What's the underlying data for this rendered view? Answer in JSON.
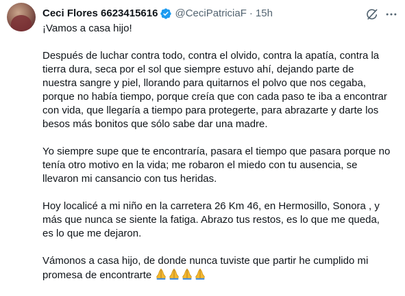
{
  "author": {
    "display_name": "Ceci Flores 6623415616",
    "handle": "@CeciPatriciaF",
    "separator": "·",
    "timestamp": "15h"
  },
  "icons": {
    "verified": "verified-badge-icon",
    "grok": "grok-icon",
    "more": "more-options-icon",
    "emoji": "folded-hands-emoji"
  },
  "colors": {
    "verified_blue": "#1d9bf0",
    "secondary_text": "#536471",
    "primary_text": "#0f1419"
  },
  "tweet": {
    "paragraphs": [
      "¡Vamos a casa hijo!",
      "Después de luchar contra todo, contra el olvido, contra la apatía, contra la\ntierra dura, seca por el sol que siempre estuvo ahí, dejando parte de\nnuestra sangre y piel, llorando para quitarnos el polvo que nos cegaba,\nporque no había tiempo, porque creía que con cada paso te iba a encontrar\ncon vida, que llegaría a tiempo para protegerte, para abrazarte y darte los\nbesos más bonitos que sólo sabe dar una madre.",
      "Yo siempre supe que te encontraría, pasara el tiempo que pasara porque no\ntenía otro motivo en la vida; me robaron el miedo con tu ausencia, se\nllevaron mi cansancio con tus heridas.",
      "Hoy localicé a mi niño en la carretera 26 Km 46, en Hermosillo, Sonora , y\nmás que nunca se siente la fatiga. Abrazo tus restos, es lo que me queda,\nes lo que me dejaron.",
      "Vámonos a casa hijo, de donde nunca tuviste que partir he cumplido mi\npromesa de encontrarte "
    ],
    "emoji_count": 4
  }
}
